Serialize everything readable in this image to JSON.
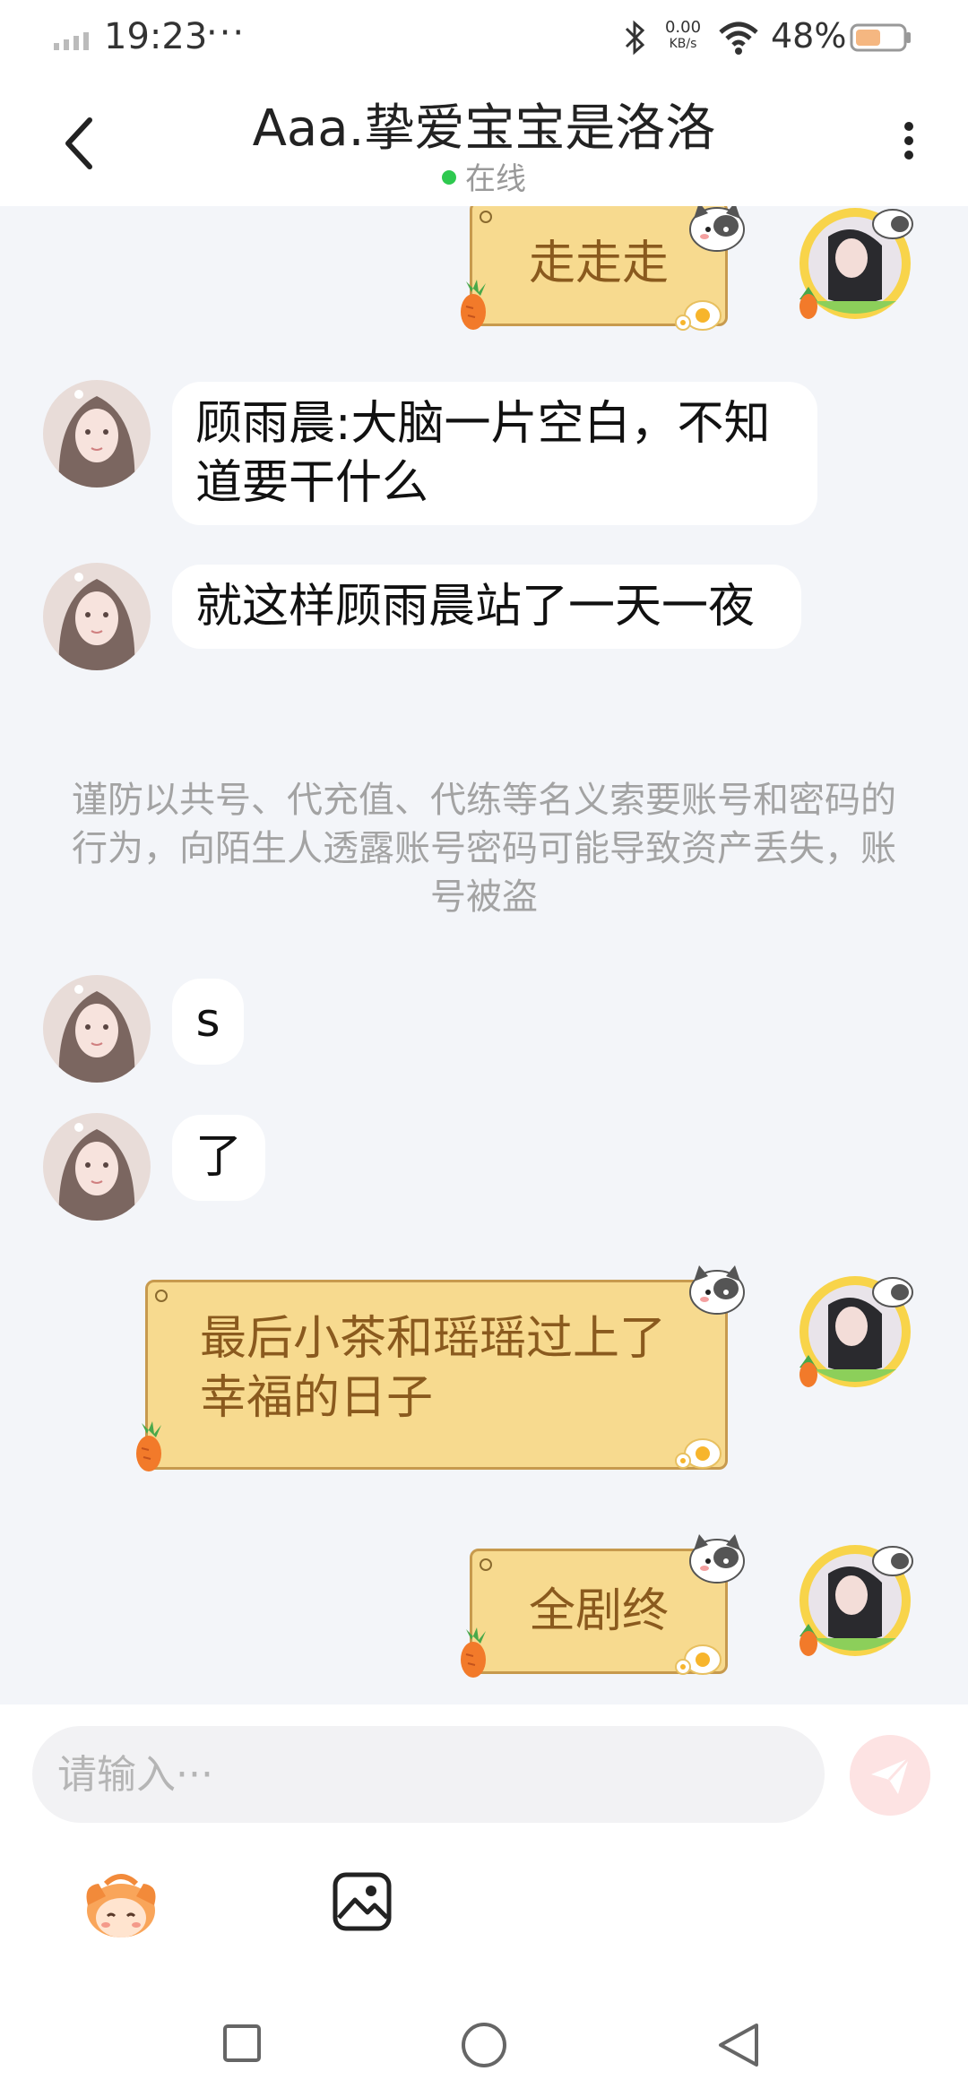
{
  "status_bar": {
    "time": "19:23",
    "dots": "···",
    "net_speed_value": "0.00",
    "net_speed_unit": "KB/s",
    "battery": "48%"
  },
  "header": {
    "title": "Aaa.挚爱宝宝是洛洛",
    "status": "在线"
  },
  "messages": [
    {
      "side": "right",
      "text": "走走走"
    },
    {
      "side": "left",
      "text": "顾雨晨:大脑一片空白，不知道要干什么"
    },
    {
      "side": "left",
      "text": "就这样顾雨晨站了一天一夜"
    },
    {
      "side": "notice",
      "text": "谨防以共号、代充值、代练等名义索要账号和密码的行为，向陌生人透露账号密码可能导致资产丢失，账号被盗"
    },
    {
      "side": "left",
      "text": "s"
    },
    {
      "side": "left",
      "text": "了"
    },
    {
      "side": "right",
      "text": "最后小茶和瑶瑶过上了幸福的日子"
    },
    {
      "side": "right",
      "text": "全剧终"
    }
  ],
  "input": {
    "placeholder": "请输入···",
    "value": ""
  },
  "icons": {
    "back": "chevron-left-icon",
    "more": "more-vertical-icon",
    "send": "send-icon",
    "emoji": "sticker-icon",
    "image": "image-icon",
    "nav": [
      "square-icon",
      "circle-icon",
      "triangle-back-icon"
    ]
  },
  "colors": {
    "online": "#2ec94f",
    "bubble_right_bg": "#f7da8f",
    "bubble_right_text": "#8a5a1e",
    "chat_bg": "#f3f5f9",
    "send_button": "#fde3e3"
  }
}
